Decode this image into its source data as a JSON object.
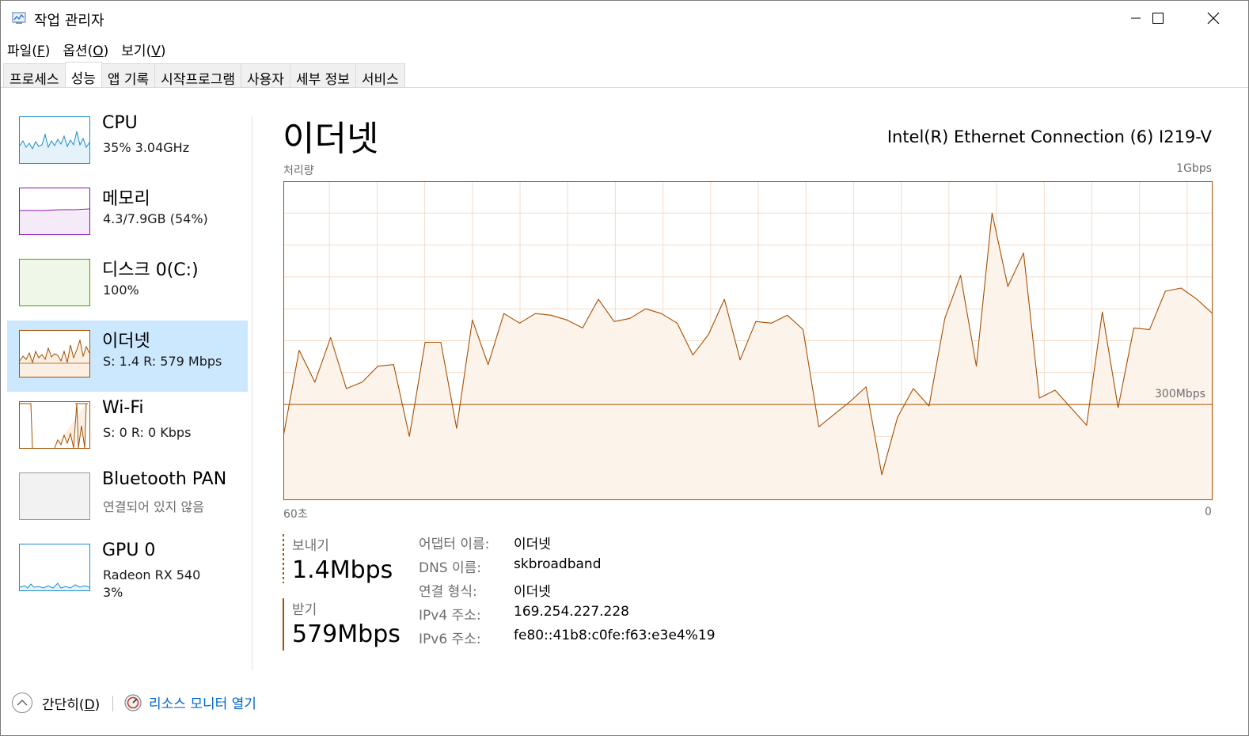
{
  "window": {
    "title": "작업 관리자",
    "minimize_icon": "minimize-icon",
    "maximize_icon": "maximize-icon",
    "close_icon": "close-icon"
  },
  "menu": {
    "items": [
      {
        "label": "파일(",
        "key": "F",
        "end": ")"
      },
      {
        "label": "옵션(",
        "key": "O",
        "end": ")"
      },
      {
        "label": "보기(",
        "key": "V",
        "end": ")"
      }
    ]
  },
  "tabs": [
    "프로세스",
    "성능",
    "앱 기록",
    "시작프로그램",
    "사용자",
    "세부 정보",
    "서비스"
  ],
  "active_tab": "성능",
  "sidebar": {
    "items": [
      {
        "name": "CPU",
        "sub": "35%  3.04GHz",
        "sub2": "",
        "color": "#1c8ccb"
      },
      {
        "name": "메모리",
        "sub": "4.3/7.9GB (54%)",
        "sub2": "",
        "color": "#8b12ae"
      },
      {
        "name": "디스크 0(C:)",
        "sub": "100%",
        "sub2": "",
        "color": "#4da000"
      },
      {
        "name": "이더넷",
        "sub": "S: 1.4  R: 579 Mbps",
        "sub2": "",
        "color": "#a74f01"
      },
      {
        "name": "Wi-Fi",
        "sub": "S: 0  R: 0 Kbps",
        "sub2": "",
        "color": "#a74f01"
      },
      {
        "name": "Bluetooth PAN",
        "sub": "연결되어 있지 않음",
        "sub2": "",
        "color": "#9a9a9a"
      },
      {
        "name": "GPU 0",
        "sub": "Radeon RX 540",
        "sub2": "3%",
        "color": "#1c8ccb"
      }
    ]
  },
  "main": {
    "title": "이더넷",
    "adapter": "Intel(R) Ethernet Connection (6) I219-V",
    "throughput_label": "처리량",
    "max_label": "1Gbps",
    "mid_label": "300Mbps",
    "time_left": "60초",
    "time_right": "0",
    "accent_color": "#a74f01",
    "fill_color": "#fcf3eb"
  },
  "chart_data": {
    "type": "area",
    "title": "",
    "ylabel": "처리량",
    "ylim": [
      0,
      1000
    ],
    "y_unit": "Mbps",
    "reference_line": 300,
    "x_range": [
      60,
      0
    ],
    "series": [
      {
        "values": [
          200,
          470,
          370,
          510,
          350,
          370,
          420,
          425,
          200,
          495,
          495,
          225,
          565,
          425,
          585,
          555,
          585,
          580,
          565,
          540,
          630,
          560,
          570,
          600,
          585,
          555,
          455,
          520,
          630,
          440,
          560,
          555,
          580,
          535,
          230,
          270,
          310,
          355,
          80,
          260,
          350,
          295,
          570,
          705,
          420,
          900,
          670,
          775,
          320,
          345,
          290,
          235,
          590,
          290,
          540,
          535,
          655,
          665,
          630,
          585
        ]
      }
    ]
  },
  "stats": {
    "send_label": "보내기",
    "send_value": "1.4Mbps",
    "recv_label": "받기",
    "recv_value": "579Mbps"
  },
  "properties": [
    {
      "key": "어댑터 이름:",
      "value": "이더넷"
    },
    {
      "key": "DNS 이름:",
      "value": "skbroadband"
    },
    {
      "key": "연결 형식:",
      "value": "이더넷"
    },
    {
      "key": "IPv4 주소:",
      "value": "169.254.227.228"
    },
    {
      "key": "IPv6 주소:",
      "value": "fe80::41b8:c0fe:f63:e3e4%19"
    }
  ],
  "footer": {
    "simple_label": "간단히(",
    "simple_key": "D",
    "simple_end": ")",
    "resmon_label": "리소스 모니터 열기"
  }
}
